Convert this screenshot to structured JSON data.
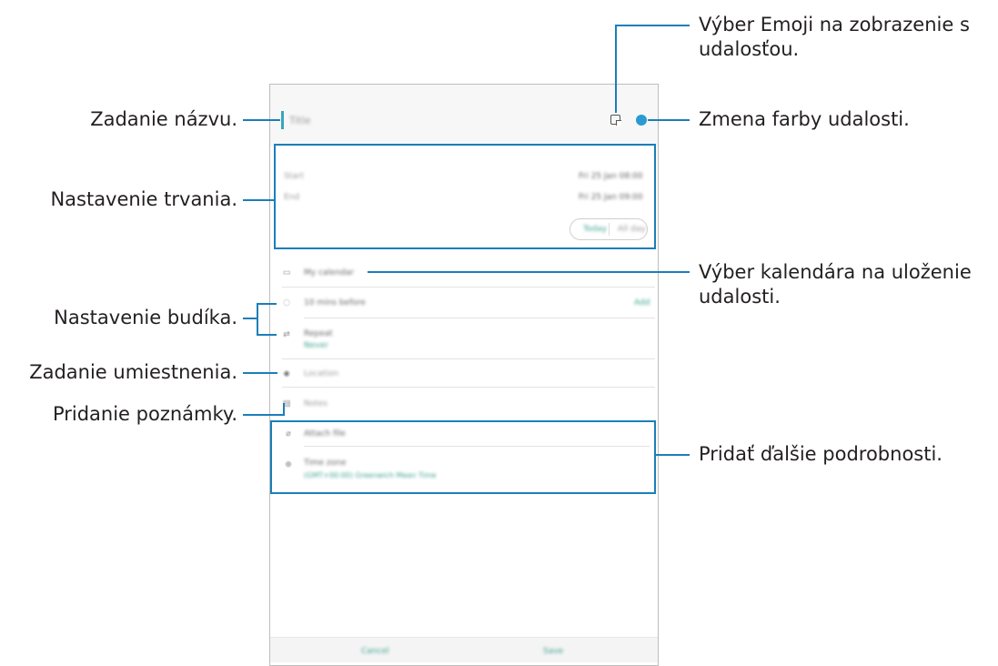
{
  "callouts": {
    "title": "Zadanie názvu.",
    "duration": "Nastavenie trvania.",
    "alarm": "Nastavenie budíka.",
    "location": "Zadanie umiestnenia.",
    "notes": "Pridanie poznámky.",
    "emoji": "Výber Emoji na zobrazenie s udalosťou.",
    "color": "Zmena farby udalosti.",
    "calendar": "Výber kalendára na uloženie udalosti.",
    "details": "Pridať ďalšie podrobnosti."
  },
  "colors": {
    "accent": "#1a7fb8",
    "event_color": "#2a9ad2"
  },
  "screen": {
    "title_placeholder": "Title",
    "start_label": "Start",
    "start_value": "Fri 25 Jan 08:00",
    "end_label": "End",
    "end_value": "Fri 25 Jan 09:00",
    "toggle_left": "Today",
    "toggle_right": "All day",
    "calendar_name": "My calendar",
    "reminder": "10 mins before",
    "reminder_action": "Add",
    "repeat_label": "Repeat",
    "repeat_value": "Never",
    "location": "Location",
    "notes": "Notes",
    "attach": "Attach file",
    "timezone_label": "Time zone",
    "timezone_value": "(GMT+00:00) Greenwich Mean Time",
    "cancel": "Cancel",
    "save": "Save"
  }
}
